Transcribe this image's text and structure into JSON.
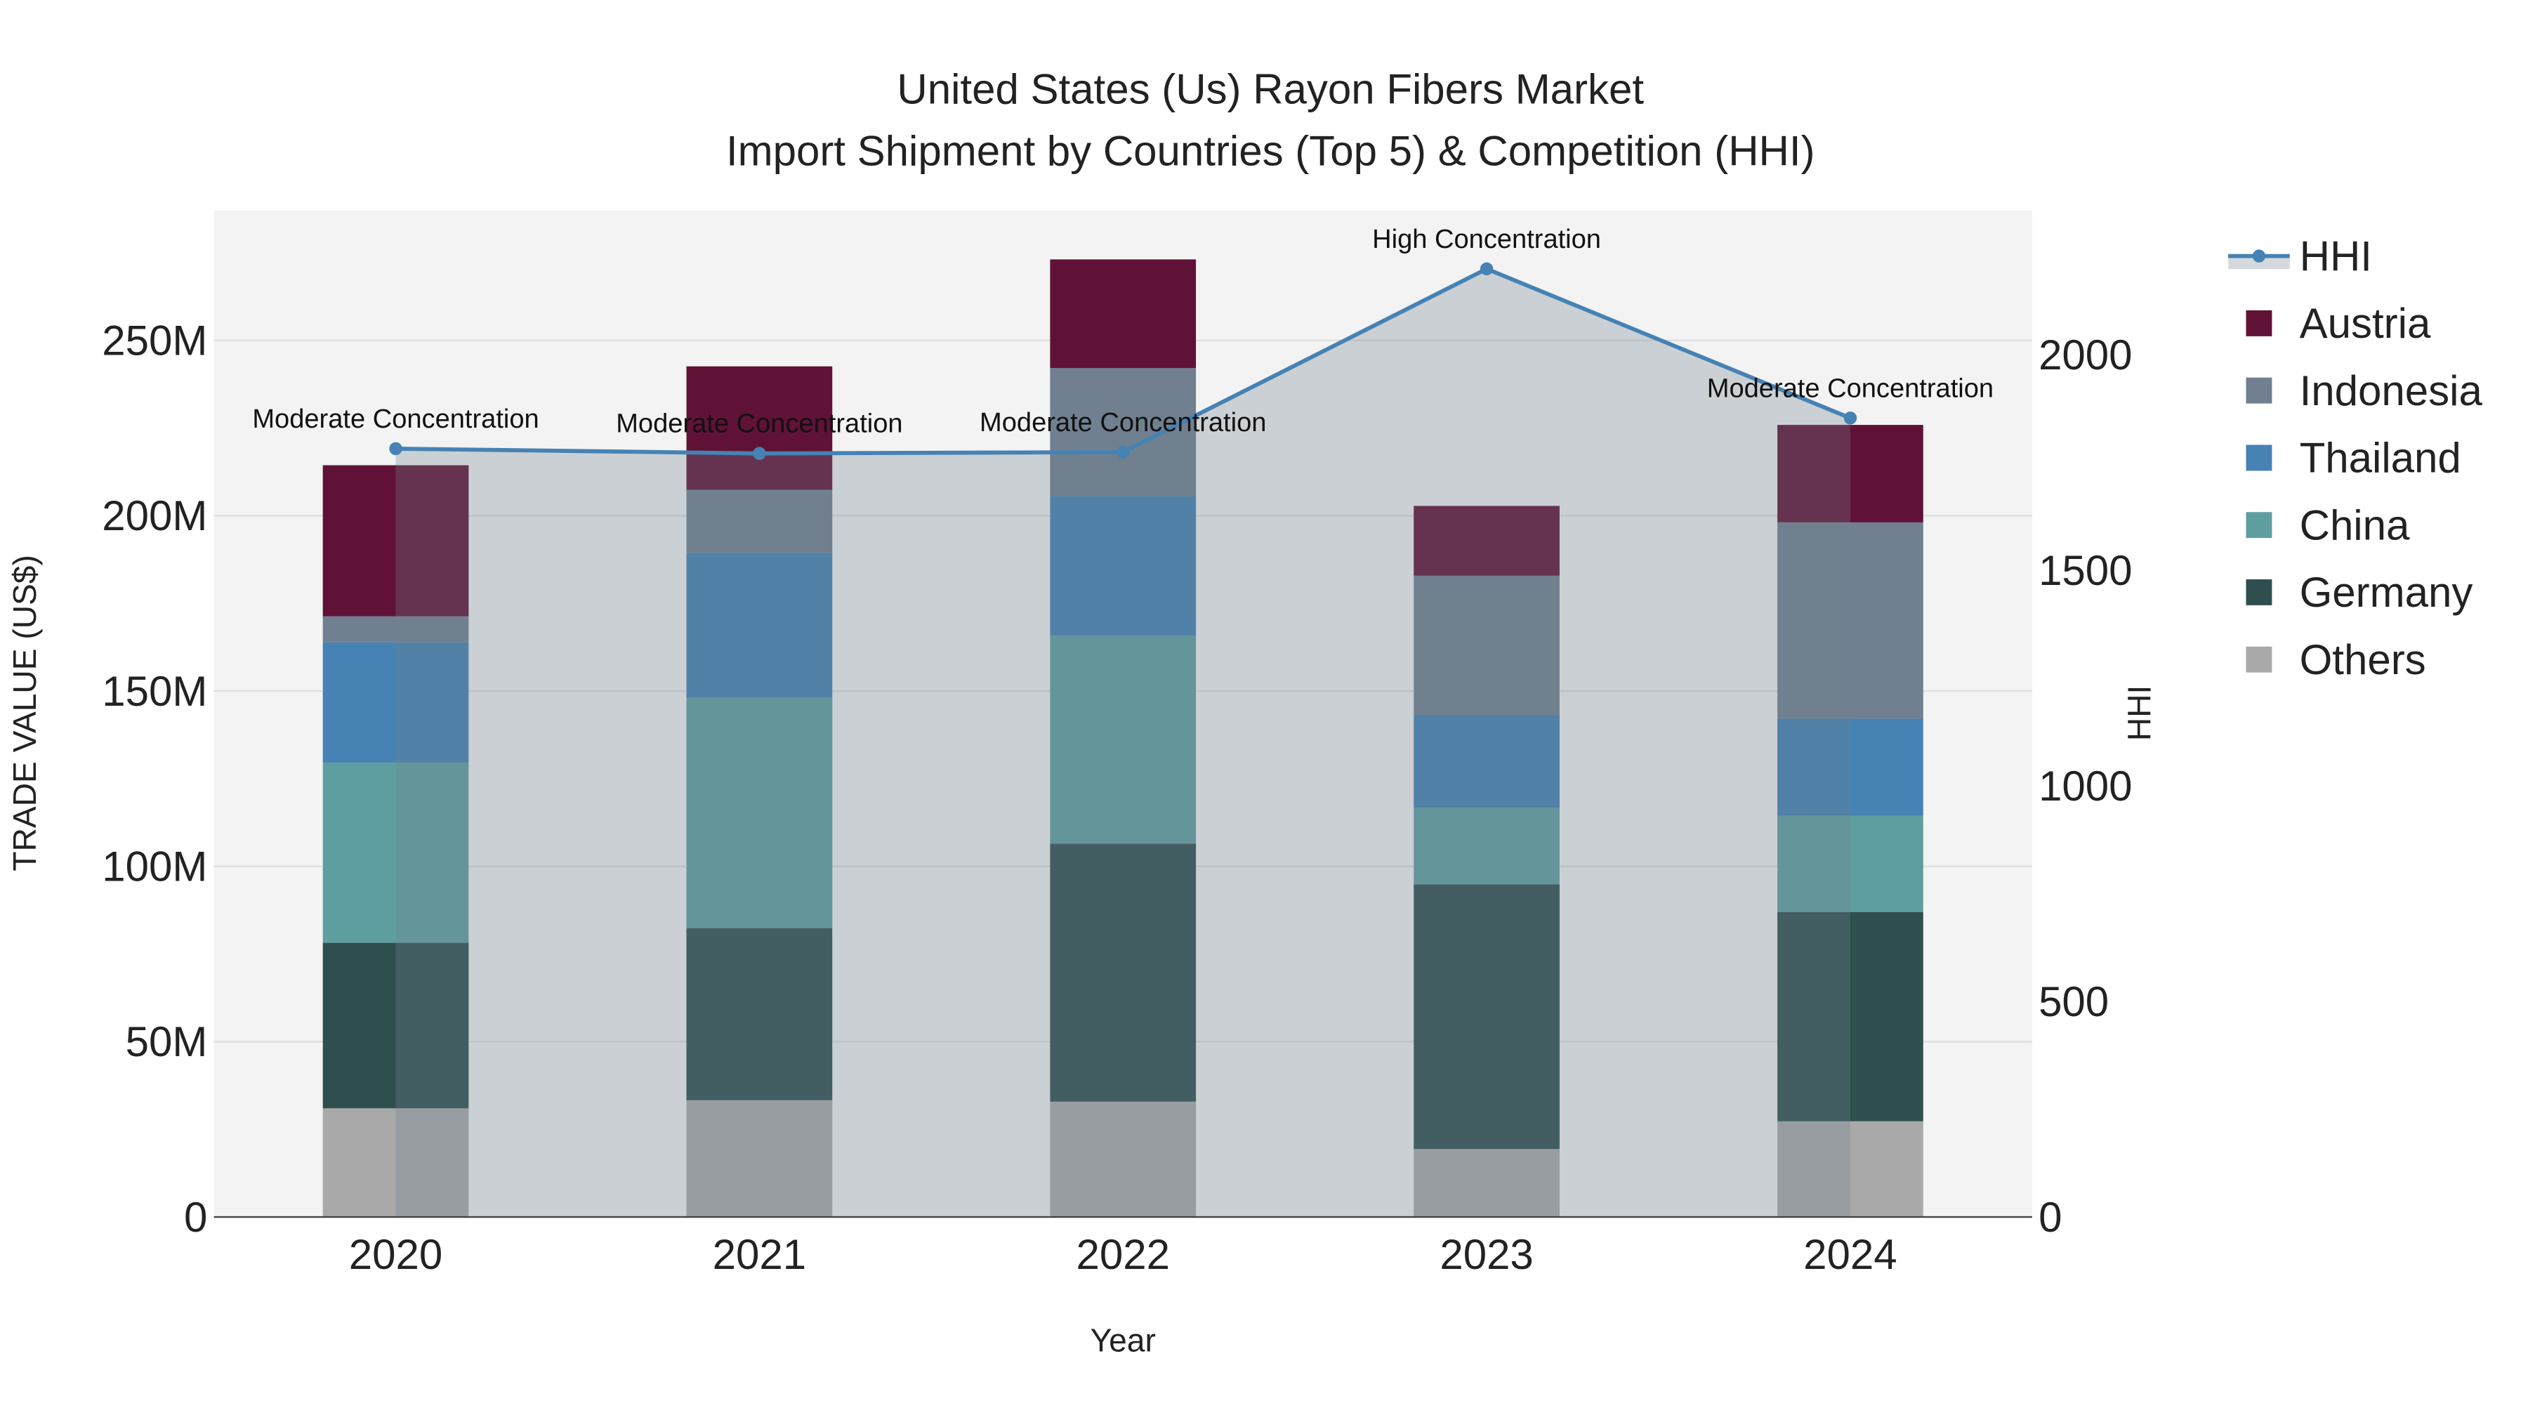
{
  "chart_data": {
    "type": "bar",
    "title": "United States (Us) Rayon Fibers Market",
    "subtitle": "Import Shipment by Countries (Top 5) & Competition (HHI)",
    "xlabel": "Year",
    "ylabel": "TRADE VALUE (US$)",
    "y2label": "HHI",
    "categories": [
      "2020",
      "2021",
      "2022",
      "2023",
      "2024"
    ],
    "ylim": [
      0,
      287
    ],
    "y_ticks": [
      0,
      50,
      100,
      150,
      200,
      250
    ],
    "y_tick_labels": [
      "0",
      "50M",
      "100M",
      "150M",
      "200M",
      "250M"
    ],
    "y2lim": [
      0,
      2334
    ],
    "y2_ticks": [
      0,
      500,
      1000,
      1500,
      2000
    ],
    "y2_tick_labels": [
      "0",
      "500",
      "1000",
      "1500",
      "2000"
    ],
    "stacked": true,
    "units": "US$ millions",
    "series": [
      {
        "name": "Others",
        "color": "#a9a9a9",
        "values": [
          31.0,
          33.3,
          32.9,
          19.4,
          27.3
        ]
      },
      {
        "name": "Germany",
        "color": "#2f4f4f",
        "values": [
          47.2,
          49.1,
          73.6,
          75.5,
          59.7
        ]
      },
      {
        "name": "China",
        "color": "#5f9ea0",
        "values": [
          51.4,
          65.7,
          59.2,
          21.8,
          27.4
        ]
      },
      {
        "name": "Thailand",
        "color": "#4682b4",
        "values": [
          34.3,
          41.3,
          39.9,
          26.4,
          27.7
        ]
      },
      {
        "name": "Indonesia",
        "color": "#708090",
        "values": [
          7.4,
          18.0,
          36.5,
          39.8,
          56.0
        ]
      },
      {
        "name": "Austria",
        "color": "#601236",
        "values": [
          43.1,
          35.2,
          31.0,
          19.9,
          27.8
        ]
      }
    ],
    "line": {
      "name": "HHI",
      "color": "#4682b4",
      "values": [
        1782,
        1771,
        1774,
        2199,
        1853
      ],
      "annotations": [
        "Moderate Concentration",
        "Moderate Concentration",
        "Moderate Concentration",
        "High Concentration",
        "Moderate Concentration"
      ]
    },
    "legend": [
      "HHI",
      "Austria",
      "Indonesia",
      "Thailand",
      "China",
      "Germany",
      "Others"
    ],
    "legend_placement": "right",
    "grid": true
  }
}
